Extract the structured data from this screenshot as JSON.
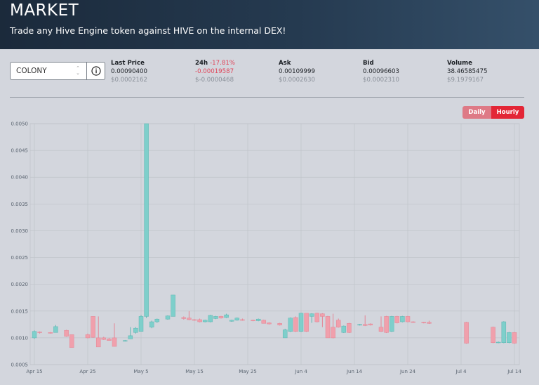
{
  "header": {
    "title": "MARKET",
    "subtitle": "Trade any Hive Engine token against HIVE on the internal DEX!"
  },
  "token_select": {
    "value": "COLONY",
    "caret_up": "⌃",
    "caret_down": "⌄"
  },
  "stats": {
    "last_price": {
      "label": "Last Price",
      "value": "0.00090400",
      "usd": "$0.0002162"
    },
    "change_24h": {
      "label": "24h",
      "pct": "-17.81%",
      "value": "-0.00019587",
      "usd": "$-0.0000468"
    },
    "ask": {
      "label": "Ask",
      "value": "0.00109999",
      "usd": "$0.0002630"
    },
    "bid": {
      "label": "Bid",
      "value": "0.00096603",
      "usd": "$0.0002310"
    },
    "volume": {
      "label": "Volume",
      "value": "38.46585475",
      "usd": "$9.1979167"
    }
  },
  "toggle": {
    "daily": "Daily",
    "hourly": "Hourly",
    "active": "hourly"
  },
  "colors": {
    "up": "#7ecfcb",
    "down": "#f0a0ac",
    "active_toggle": "#e32636",
    "inactive_toggle": "#de7a86"
  },
  "chart_data": {
    "type": "candlestick",
    "title": "",
    "ylim": [
      0.0005,
      0.005
    ],
    "y_ticks": [
      "0.0050",
      "0.0045",
      "0.0040",
      "0.0035",
      "0.0030",
      "0.0025",
      "0.0020",
      "0.0015",
      "0.0010",
      "0.0005"
    ],
    "x_ticks": [
      "Apr 15",
      "Apr 25",
      "May 5",
      "May 15",
      "May 25",
      "Jun 4",
      "Jun 14",
      "Jun 24",
      "Jul 4",
      "Jul 14"
    ],
    "x_range": [
      "Apr 15",
      "Jul 14"
    ],
    "grid": true,
    "candles": [
      {
        "date": "Apr 15",
        "open": 0.001,
        "close": 0.00112,
        "high": 0.00114,
        "low": 0.00098
      },
      {
        "date": "Apr 16",
        "open": 0.00111,
        "close": 0.0011,
        "high": 0.00112,
        "low": 0.00108
      },
      {
        "date": "Apr 18",
        "open": 0.0011,
        "close": 0.00109,
        "high": 0.00111,
        "low": 0.00108
      },
      {
        "date": "Apr 19",
        "open": 0.0011,
        "close": 0.00121,
        "high": 0.00124,
        "low": 0.0011
      },
      {
        "date": "Apr 21",
        "open": 0.00114,
        "close": 0.00103,
        "high": 0.00115,
        "low": 0.00102
      },
      {
        "date": "Apr 22",
        "open": 0.00106,
        "close": 0.00082,
        "high": 0.00106,
        "low": 0.00082
      },
      {
        "date": "Apr 25",
        "open": 0.00106,
        "close": 0.001,
        "high": 0.00108,
        "low": 0.00099
      },
      {
        "date": "Apr 26",
        "open": 0.0014,
        "close": 0.00101,
        "high": 0.0014,
        "low": 0.001
      },
      {
        "date": "Apr 27",
        "open": 0.001,
        "close": 0.00083,
        "high": 0.0014,
        "low": 0.00083
      },
      {
        "date": "Apr 28",
        "open": 0.001,
        "close": 0.00097,
        "high": 0.00102,
        "low": 0.00096
      },
      {
        "date": "Apr 29",
        "open": 0.00098,
        "close": 0.00095,
        "high": 0.001,
        "low": 0.00095
      },
      {
        "date": "Apr 30",
        "open": 0.001,
        "close": 0.00084,
        "high": 0.00127,
        "low": 0.00084
      },
      {
        "date": "May 2",
        "open": 0.00094,
        "close": 0.00095,
        "high": 0.00096,
        "low": 0.00093
      },
      {
        "date": "May 3",
        "open": 0.00098,
        "close": 0.00104,
        "high": 0.0012,
        "low": 0.00098
      },
      {
        "date": "May 4",
        "open": 0.0011,
        "close": 0.00118,
        "high": 0.0012,
        "low": 0.00108
      },
      {
        "date": "May 5",
        "open": 0.00112,
        "close": 0.0014,
        "high": 0.00143,
        "low": 0.00112
      },
      {
        "date": "May 6",
        "open": 0.0014,
        "close": 0.005,
        "high": 0.005,
        "low": 0.00137
      },
      {
        "date": "May 7",
        "open": 0.0012,
        "close": 0.0013,
        "high": 0.00132,
        "low": 0.00118
      },
      {
        "date": "May 8",
        "open": 0.0013,
        "close": 0.00135,
        "high": 0.00136,
        "low": 0.00128
      },
      {
        "date": "May 10",
        "open": 0.00135,
        "close": 0.00141,
        "high": 0.00142,
        "low": 0.00134
      },
      {
        "date": "May 11",
        "open": 0.0014,
        "close": 0.0018,
        "high": 0.0018,
        "low": 0.0014
      },
      {
        "date": "May 13",
        "open": 0.00138,
        "close": 0.00136,
        "high": 0.0014,
        "low": 0.00134
      },
      {
        "date": "May 14",
        "open": 0.00137,
        "close": 0.00134,
        "high": 0.0015,
        "low": 0.00133
      },
      {
        "date": "May 15",
        "open": 0.00134,
        "close": 0.00133,
        "high": 0.00135,
        "low": 0.00132
      },
      {
        "date": "May 16",
        "open": 0.00134,
        "close": 0.0013,
        "high": 0.00136,
        "low": 0.00129
      },
      {
        "date": "May 17",
        "open": 0.0013,
        "close": 0.00133,
        "high": 0.00134,
        "low": 0.00129
      },
      {
        "date": "May 18",
        "open": 0.0013,
        "close": 0.00142,
        "high": 0.00143,
        "low": 0.00129
      },
      {
        "date": "May 19",
        "open": 0.00136,
        "close": 0.0014,
        "high": 0.00141,
        "low": 0.00135
      },
      {
        "date": "May 20",
        "open": 0.0014,
        "close": 0.00137,
        "high": 0.00141,
        "low": 0.00136
      },
      {
        "date": "May 21",
        "open": 0.00138,
        "close": 0.00143,
        "high": 0.00145,
        "low": 0.00137
      },
      {
        "date": "May 22",
        "open": 0.00131,
        "close": 0.00133,
        "high": 0.00134,
        "low": 0.0013
      },
      {
        "date": "May 23",
        "open": 0.00133,
        "close": 0.00137,
        "high": 0.00138,
        "low": 0.00132
      },
      {
        "date": "May 24",
        "open": 0.00134,
        "close": 0.00133,
        "high": 0.00136,
        "low": 0.00132
      },
      {
        "date": "May 26",
        "open": 0.00133,
        "close": 0.00132,
        "high": 0.00134,
        "low": 0.00131
      },
      {
        "date": "May 27",
        "open": 0.00132,
        "close": 0.00135,
        "high": 0.00136,
        "low": 0.00131
      },
      {
        "date": "May 28",
        "open": 0.00133,
        "close": 0.00127,
        "high": 0.00134,
        "low": 0.00127
      },
      {
        "date": "May 29",
        "open": 0.00128,
        "close": 0.00126,
        "high": 0.00129,
        "low": 0.00125
      },
      {
        "date": "May 31",
        "open": 0.00127,
        "close": 0.00124,
        "high": 0.00128,
        "low": 0.00123
      },
      {
        "date": "Jun 1",
        "open": 0.001,
        "close": 0.00115,
        "high": 0.00117,
        "low": 0.001
      },
      {
        "date": "Jun 2",
        "open": 0.00112,
        "close": 0.00137,
        "high": 0.00138,
        "low": 0.00111
      },
      {
        "date": "Jun 3",
        "open": 0.00138,
        "close": 0.00112,
        "high": 0.0014,
        "low": 0.00111
      },
      {
        "date": "Jun 4",
        "open": 0.00112,
        "close": 0.00146,
        "high": 0.00147,
        "low": 0.00111
      },
      {
        "date": "Jun 5",
        "open": 0.00146,
        "close": 0.00112,
        "high": 0.00146,
        "low": 0.00111
      },
      {
        "date": "Jun 6",
        "open": 0.0014,
        "close": 0.00145,
        "high": 0.00146,
        "low": 0.00128
      },
      {
        "date": "Jun 7",
        "open": 0.00146,
        "close": 0.0013,
        "high": 0.00147,
        "low": 0.00129
      },
      {
        "date": "Jun 8",
        "open": 0.00145,
        "close": 0.0014,
        "high": 0.00146,
        "low": 0.0012
      },
      {
        "date": "Jun 9",
        "open": 0.0014,
        "close": 0.001,
        "high": 0.00141,
        "low": 0.001
      },
      {
        "date": "Jun 10",
        "open": 0.0012,
        "close": 0.001,
        "high": 0.00145,
        "low": 0.00099
      },
      {
        "date": "Jun 11",
        "open": 0.00133,
        "close": 0.0012,
        "high": 0.00136,
        "low": 0.00119
      },
      {
        "date": "Jun 12",
        "open": 0.0011,
        "close": 0.00122,
        "high": 0.00123,
        "low": 0.00109
      },
      {
        "date": "Jun 13",
        "open": 0.00127,
        "close": 0.0011,
        "high": 0.00128,
        "low": 0.00109
      },
      {
        "date": "Jun 15",
        "open": 0.00124,
        "close": 0.00125,
        "high": 0.00126,
        "low": 0.00123
      },
      {
        "date": "Jun 16",
        "open": 0.00125,
        "close": 0.00123,
        "high": 0.00142,
        "low": 0.00122
      },
      {
        "date": "Jun 17",
        "open": 0.00126,
        "close": 0.00124,
        "high": 0.00127,
        "low": 0.00123
      },
      {
        "date": "Jun 19",
        "open": 0.0012,
        "close": 0.00112,
        "high": 0.0014,
        "low": 0.00111
      },
      {
        "date": "Jun 20",
        "open": 0.0014,
        "close": 0.0011,
        "high": 0.00141,
        "low": 0.00109
      },
      {
        "date": "Jun 21",
        "open": 0.00112,
        "close": 0.0014,
        "high": 0.00141,
        "low": 0.00111
      },
      {
        "date": "Jun 22",
        "open": 0.0014,
        "close": 0.00128,
        "high": 0.00141,
        "low": 0.00127
      },
      {
        "date": "Jun 23",
        "open": 0.0013,
        "close": 0.0014,
        "high": 0.00141,
        "low": 0.00129
      },
      {
        "date": "Jun 24",
        "open": 0.0014,
        "close": 0.0013,
        "high": 0.00141,
        "low": 0.00129
      },
      {
        "date": "Jun 25",
        "open": 0.0013,
        "close": 0.00129,
        "high": 0.00131,
        "low": 0.00128
      },
      {
        "date": "Jun 27",
        "open": 0.00129,
        "close": 0.00128,
        "high": 0.0013,
        "low": 0.00127
      },
      {
        "date": "Jun 28",
        "open": 0.00129,
        "close": 0.00127,
        "high": 0.00132,
        "low": 0.00126
      },
      {
        "date": "Jul 5",
        "open": 0.00129,
        "close": 0.0009,
        "high": 0.0013,
        "low": 0.00089
      },
      {
        "date": "Jul 10",
        "open": 0.0012,
        "close": 0.00091,
        "high": 0.00121,
        "low": 0.0009
      },
      {
        "date": "Jul 11",
        "open": 0.00091,
        "close": 0.00092,
        "high": 0.00093,
        "low": 0.0009
      },
      {
        "date": "Jul 12",
        "open": 0.00091,
        "close": 0.0013,
        "high": 0.00131,
        "low": 0.0009
      },
      {
        "date": "Jul 13",
        "open": 0.00091,
        "close": 0.0011,
        "high": 0.00111,
        "low": 0.0009
      },
      {
        "date": "Jul 14",
        "open": 0.0011,
        "close": 0.0009,
        "high": 0.00111,
        "low": 0.00089
      }
    ]
  }
}
